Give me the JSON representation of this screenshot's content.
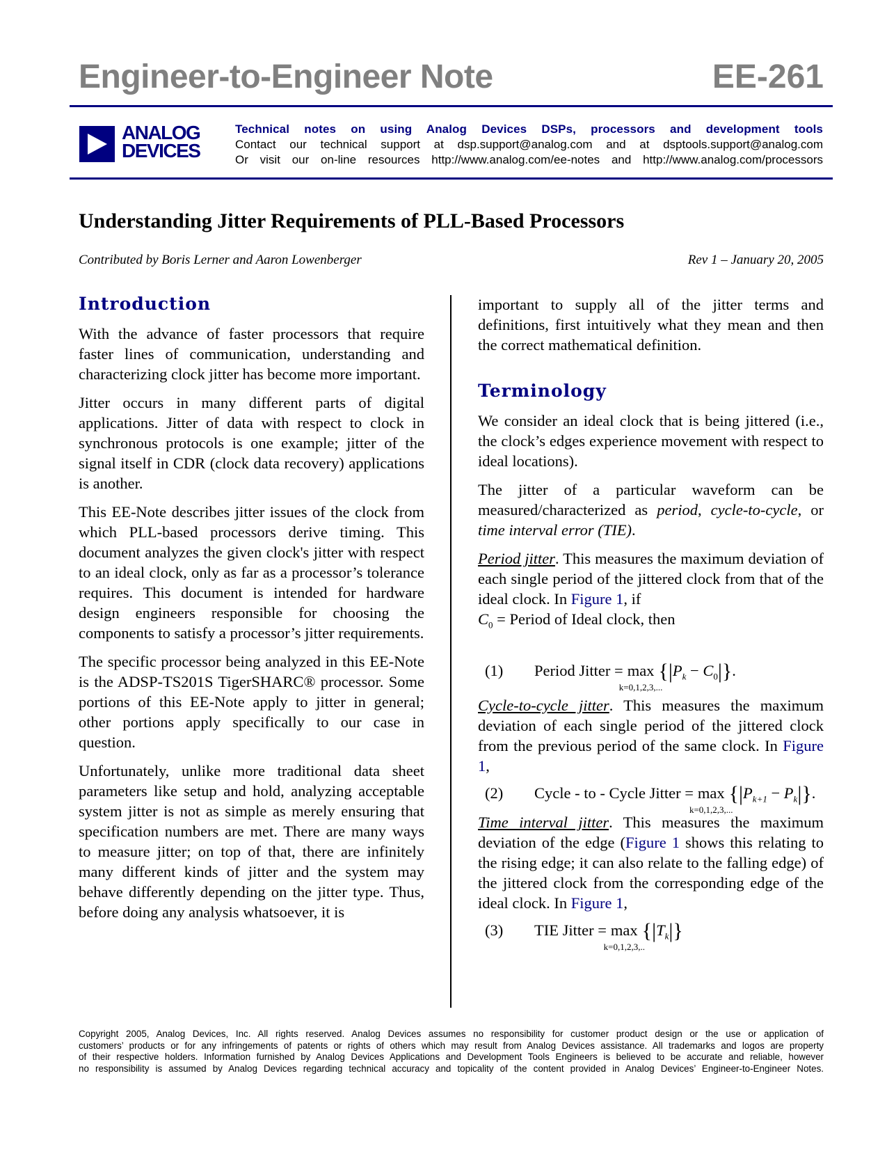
{
  "header": {
    "series_title": "Engineer-to-Engineer Note",
    "note_number": "EE-261",
    "logo": {
      "line1": "ANALOG",
      "line2": "DEVICES",
      "icon": "play-triangle-icon"
    },
    "tagline": "Technical notes on using Analog Devices DSPs, processors and development tools",
    "contact_line": "Contact our technical support at dsp.support@analog.com and at dsptools.support@analog.com",
    "resources_line": "Or visit our on-line resources http://www.analog.com/ee-notes and http://www.analog.com/processors",
    "brand_color": "#000080",
    "title_color": "#808080"
  },
  "document": {
    "title": "Understanding Jitter Requirements of PLL-Based Processors",
    "authors": "Contributed by Boris Lerner and Aaron Lowenberger",
    "revision": "Rev 1 – January 20, 2005"
  },
  "left_column": {
    "heading": "Introduction",
    "paragraphs": [
      "With the advance of faster processors that require faster lines of communication, understanding and characterizing clock jitter has become more important.",
      "Jitter occurs in many different parts of digital applications. Jitter of data with respect to clock in synchronous protocols is one example; jitter of the signal itself in CDR (clock data recovery) applications is another.",
      "This EE-Note describes jitter issues of the clock from which PLL-based processors derive timing. This document analyzes the given clock's jitter with respect to an ideal clock, only as far as a processor’s tolerance requires. This document is intended for hardware design engineers responsible for choosing the components to satisfy a processor’s jitter requirements.",
      "The specific processor being analyzed in this EE-Note is the ADSP-TS201S TigerSHARC® processor. Some portions of this EE-Note apply to jitter in general; other portions apply specifically to our case in question.",
      "Unfortunately, unlike more traditional data sheet parameters like setup and hold, analyzing acceptable system jitter is not as simple as merely ensuring that specification numbers are met. There are many ways to measure jitter; on top of that, there are infinitely many different kinds of jitter and the system may behave differently depending on the jitter type. Thus, before doing any analysis whatsoever, it is"
    ]
  },
  "right_column": {
    "continuation": "important to supply all of the jitter terms and definitions, first intuitively what they mean and then the correct mathematical definition.",
    "heading": "Terminology",
    "p1": "We consider an ideal clock that is being jittered (i.e., the clock’s edges experience movement with respect to ideal locations).",
    "p2": {
      "pre": "The jitter of a particular waveform can be measured/characterized as ",
      "t1": "period",
      "sep1": ", ",
      "t2": "cycle-to-cycle",
      "sep2": ", or ",
      "t3": "time interval error (TIE)",
      "post": "."
    },
    "period": {
      "term": "Period jitter",
      "text": ". This measures the maximum deviation of each single period of the jittered clock from that of the ideal clock. In ",
      "link": "Figure 1",
      "after": ", if",
      "def_var": "C",
      "def_sub": "0",
      "def_text": " = Period of  Ideal clock,  then"
    },
    "cycle": {
      "term": "Cycle-to-cycle jitter",
      "text": ". This measures the maximum deviation of each single period of the jittered clock from the previous period of the same clock. In ",
      "link": "Figure 1",
      "after": ","
    },
    "tie": {
      "term": "Time interval jitter",
      "text1": ". This measures the maximum deviation of the edge (",
      "link1": "Figure 1",
      "text2": " shows this relating to the rising edge; it can also relate to the falling edge) of the jittered clock from the corresponding edge of the ideal clock. In ",
      "link2": "Figure 1",
      "after": ","
    },
    "equations": [
      {
        "number": "(1)",
        "lhs": "Period Jitter =",
        "op": "max",
        "range": "k=0,1,2,3,...",
        "expr_a": "P",
        "sub_a": "k",
        "minus": " − ",
        "expr_b": "C",
        "sub_b": "0",
        "end": "."
      },
      {
        "number": "(2)",
        "lhs": "Cycle - to - Cycle Jitter =",
        "op": "max",
        "range": "k=0,1,2,3,...",
        "expr_a": "P",
        "sub_a": "k+1",
        "minus": " − ",
        "expr_b": "P",
        "sub_b": "k",
        "end": "."
      },
      {
        "number": "(3)",
        "lhs": "TIE Jitter =",
        "op": "max",
        "range": "k=0,1,2,3,..",
        "expr_a": "T",
        "sub_a": "k",
        "end": ""
      }
    ]
  },
  "footer": {
    "lines": [
      "Copyright 2005, Analog Devices, Inc. All rights reserved. Analog Devices assumes no responsibility for customer product design or the use or application of",
      "customers’ products or for any infringements of patents or rights of others which may result from Analog Devices assistance. All trademarks and logos are property",
      "of their respective holders.  Information furnished by Analog Devices Applications and Development Tools Engineers is believed to be accurate and reliable, however",
      "no responsibility is assumed by Analog Devices regarding technical accuracy and topicality of the content provided in Analog Devices’ Engineer-to-Engineer Notes."
    ]
  }
}
